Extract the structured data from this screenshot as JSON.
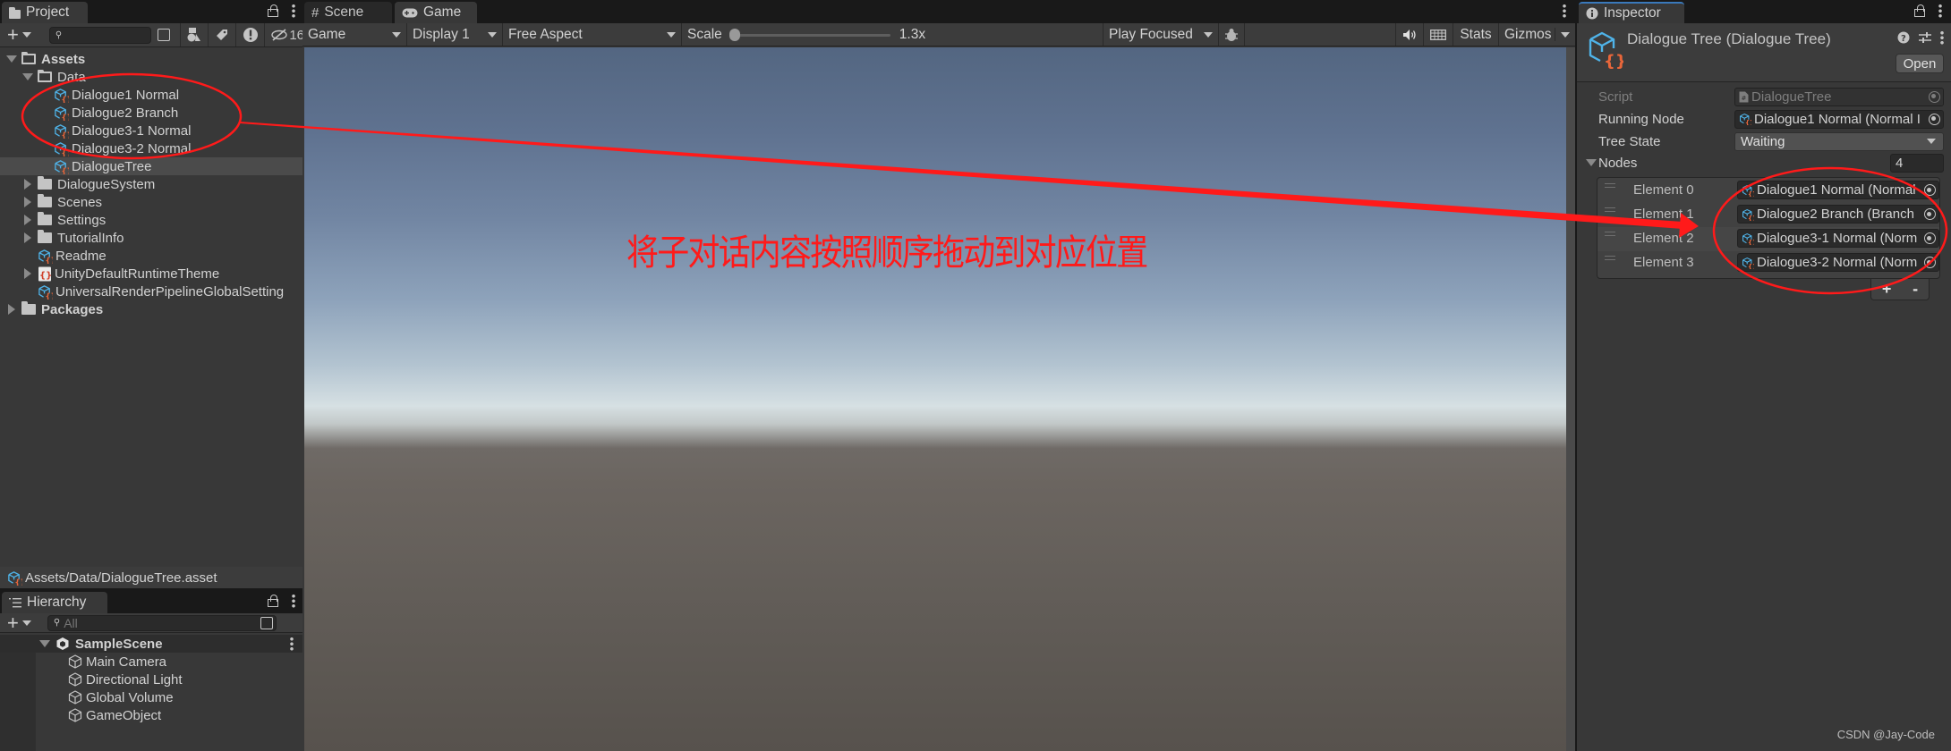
{
  "project_panel": {
    "tab_label": "Project",
    "hidden_count": "16",
    "search_placeholder": "",
    "tree": [
      {
        "label": "Assets",
        "depth": 0,
        "type": "folder-open",
        "expanded": true,
        "bold": true
      },
      {
        "label": "Data",
        "depth": 1,
        "type": "folder-open",
        "expanded": true
      },
      {
        "label": "Dialogue1 Normal",
        "depth": 2,
        "type": "scriptable-object"
      },
      {
        "label": "Dialogue2 Branch",
        "depth": 2,
        "type": "scriptable-object"
      },
      {
        "label": "Dialogue3-1 Normal",
        "depth": 2,
        "type": "scriptable-object"
      },
      {
        "label": "Dialogue3-2 Normal",
        "depth": 2,
        "type": "scriptable-object"
      },
      {
        "label": "DialogueTree",
        "depth": 2,
        "type": "scriptable-object",
        "selected": true
      },
      {
        "label": "DialogueSystem",
        "depth": 1,
        "type": "folder",
        "collapsed": true
      },
      {
        "label": "Scenes",
        "depth": 1,
        "type": "folder",
        "collapsed": true
      },
      {
        "label": "Settings",
        "depth": 1,
        "type": "folder",
        "collapsed": true
      },
      {
        "label": "TutorialInfo",
        "depth": 1,
        "type": "folder",
        "collapsed": true
      },
      {
        "label": "Readme",
        "depth": 1,
        "type": "scriptable-object"
      },
      {
        "label": "UnityDefaultRuntimeTheme",
        "depth": 1,
        "type": "theme",
        "collapsed": true
      },
      {
        "label": "UniversalRenderPipelineGlobalSetting",
        "depth": 1,
        "type": "scriptable-object"
      },
      {
        "label": "Packages",
        "depth": 0,
        "type": "folder",
        "collapsed": true,
        "bold": true
      }
    ],
    "selected_path": "Assets/Data/DialogueTree.asset"
  },
  "hierarchy_panel": {
    "tab_label": "Hierarchy",
    "search_placeholder": "All",
    "scene": "SampleScene",
    "objects": [
      "Main Camera",
      "Directional Light",
      "Global Volume",
      "GameObject"
    ]
  },
  "game_panel": {
    "tabs": [
      {
        "label": "Scene",
        "icon": "grid-icon",
        "active": false
      },
      {
        "label": "Game",
        "icon": "gamepad-icon",
        "active": true
      }
    ],
    "toolbar": {
      "view_mode": "Game",
      "display": "Display 1",
      "aspect": "Free Aspect",
      "scale_label": "Scale",
      "scale_value": "1.3x",
      "scale_fraction": 0.0,
      "play_mode": "Play Focused",
      "stats_label": "Stats",
      "gizmos_label": "Gizmos"
    },
    "annotation_text": "将子对话内容按照顺序拖动到对应位置"
  },
  "inspector": {
    "tab_label": "Inspector",
    "title": "Dialogue Tree (Dialogue Tree)",
    "open_label": "Open",
    "script_label": "Script",
    "script_value": "DialogueTree",
    "running_node_label": "Running Node",
    "running_node_value": "Dialogue1 Normal (Normal I",
    "tree_state_label": "Tree State",
    "tree_state_value": "Waiting",
    "nodes_label": "Nodes",
    "nodes_count": "4",
    "elements": [
      {
        "label": "Element 0",
        "value": "Dialogue1 Normal (Normal"
      },
      {
        "label": "Element 1",
        "value": "Dialogue2 Branch (Branch"
      },
      {
        "label": "Element 2",
        "value": "Dialogue3-1 Normal (Norm"
      },
      {
        "label": "Element 3",
        "value": "Dialogue3-2 Normal (Norm"
      }
    ],
    "add_label": "+",
    "remove_label": "-"
  },
  "watermark": "CSDN @Jay-Code",
  "colors": {
    "annotation_red": "#ff1a1a",
    "accent_blue": "#3a79bb",
    "so_icon_blue": "#4fb3e8",
    "so_icon_orange": "#e8663a"
  }
}
